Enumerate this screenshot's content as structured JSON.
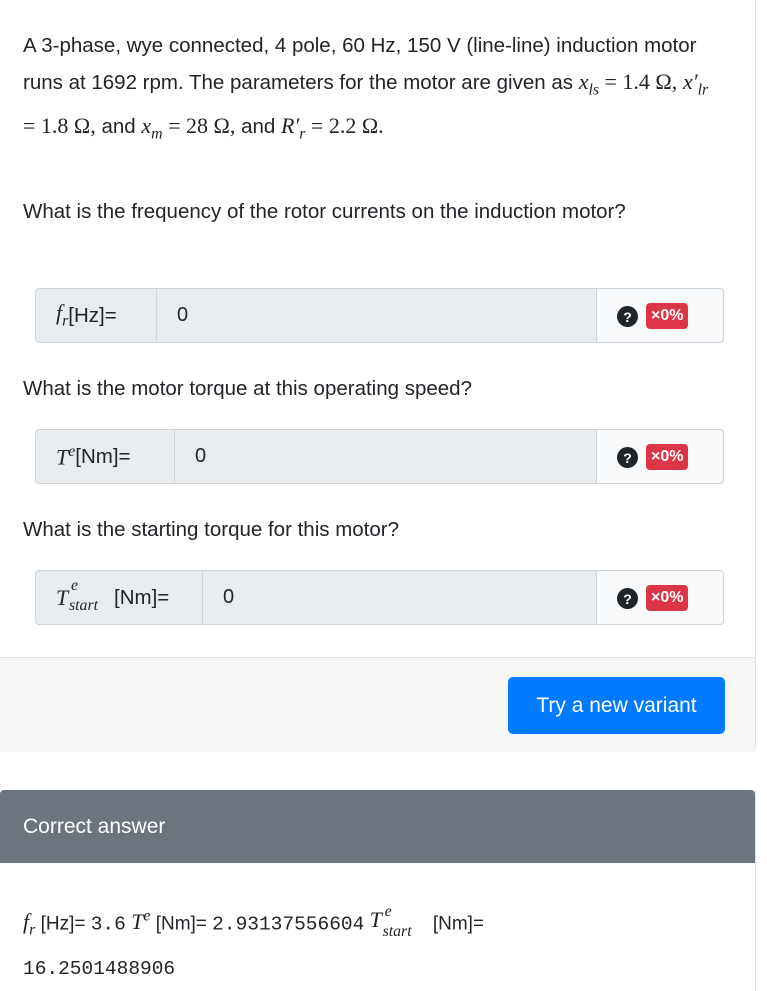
{
  "question": {
    "text_1": "A 3-phase, wye connected, 4 pole, 60 Hz, 150 V (line-line) induction motor runs at 1692 rpm. The parameters for the motor are given as",
    "xls_sym": "x",
    "xls_sub": "ls",
    "xls_val": "= 1.4 Ω,",
    "xlr_sym": "x′",
    "xlr_sub": "lr",
    "xlr_val": "= 1.8 Ω,",
    "and_1": "and",
    "xm_sym": "x",
    "xm_sub": "m",
    "xm_val": "= 28 Ω,",
    "and_2": "and",
    "rr_sym": "R′",
    "rr_sub": "r",
    "rr_val": "= 2.2 Ω."
  },
  "parts": [
    {
      "prompt": "What is the frequency of the rotor currents on the induction motor?",
      "label_sym": "f",
      "label_sub": "r",
      "label_sup": "",
      "label_unit": "[Hz]=",
      "value": "0",
      "help": "?",
      "score": "×0%"
    },
    {
      "prompt": "What is the motor torque at this operating speed?",
      "label_sym": "T",
      "label_sub": "",
      "label_sup": "e",
      "label_unit": "[Nm]=",
      "value": "0",
      "help": "?",
      "score": "×0%"
    },
    {
      "prompt": "What is the starting torque for this motor?",
      "label_sym": "T",
      "label_sub": "start",
      "label_sup": "e",
      "label_unit": "[Nm]=",
      "value": "0",
      "help": "?",
      "score": "×0%"
    }
  ],
  "footer": {
    "new_variant_label": "Try a new variant"
  },
  "answer": {
    "header": "Correct answer",
    "fr_sym": "f",
    "fr_sub": "r",
    "fr_unit": "[Hz]=",
    "fr_val": "3.6",
    "te_sym": "T",
    "te_sup": "e",
    "te_unit": "[Nm]=",
    "te_val": "2.93137556604",
    "ts_sym": "T",
    "ts_sup": "e",
    "ts_sub": "start",
    "ts_unit": "[Nm]=",
    "ts_val": "16.2501488906"
  },
  "colors": {
    "primary": "#007bff",
    "danger": "#dc3545",
    "answer_header": "#6c757d"
  }
}
